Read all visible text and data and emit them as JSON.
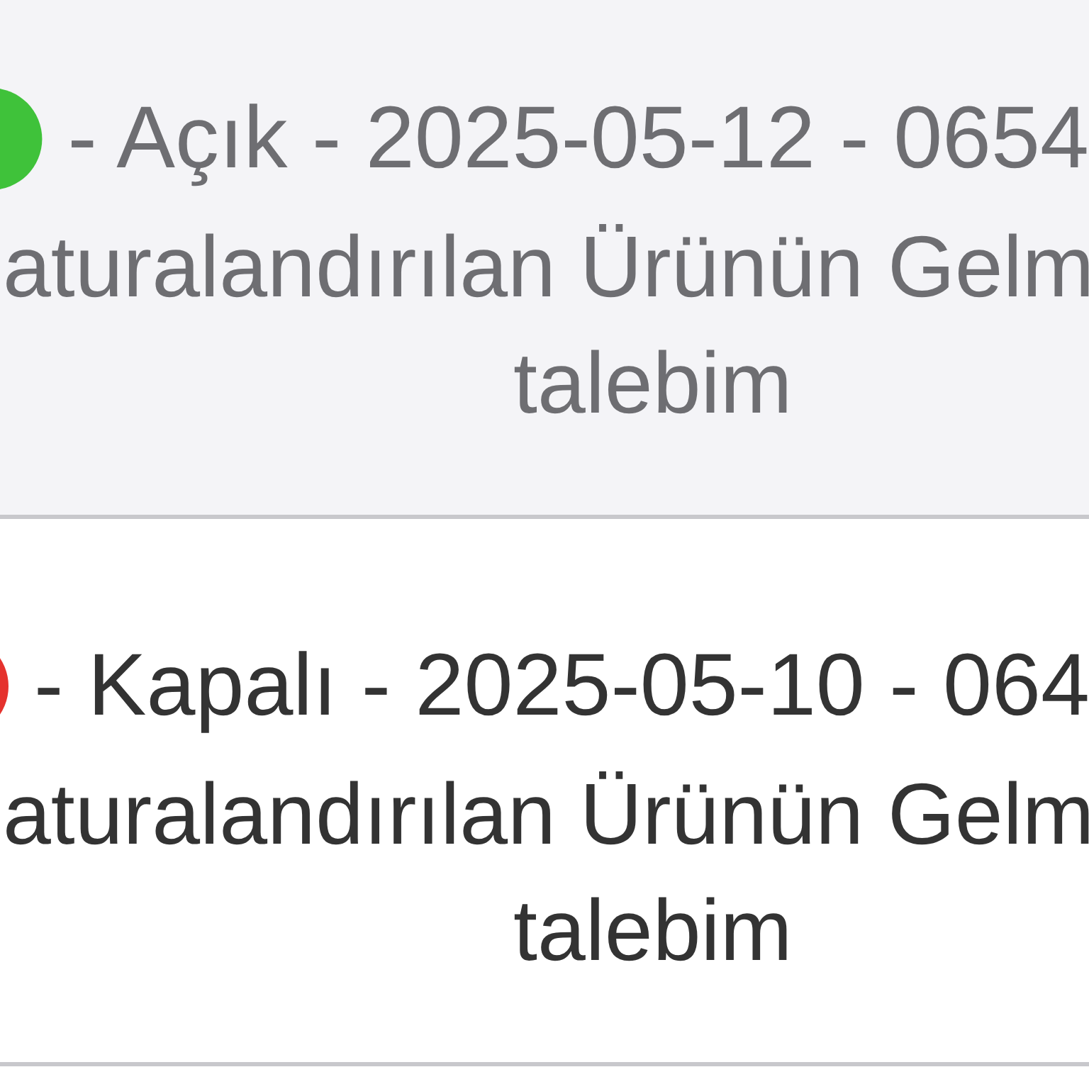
{
  "items": [
    {
      "selected": true,
      "color": "#3fc23a",
      "summary": "- Açık - 2025-05-12 - 0654",
      "description_lines": [
        "aturalandırılan Ürünün Gelm",
        "talebim"
      ]
    },
    {
      "selected": false,
      "color": "#e5322d",
      "summary": "- Kapalı - 2025-05-10 - 064",
      "description_lines": [
        "aturalandırılan Ürünün Gelm",
        "talebim"
      ]
    }
  ]
}
